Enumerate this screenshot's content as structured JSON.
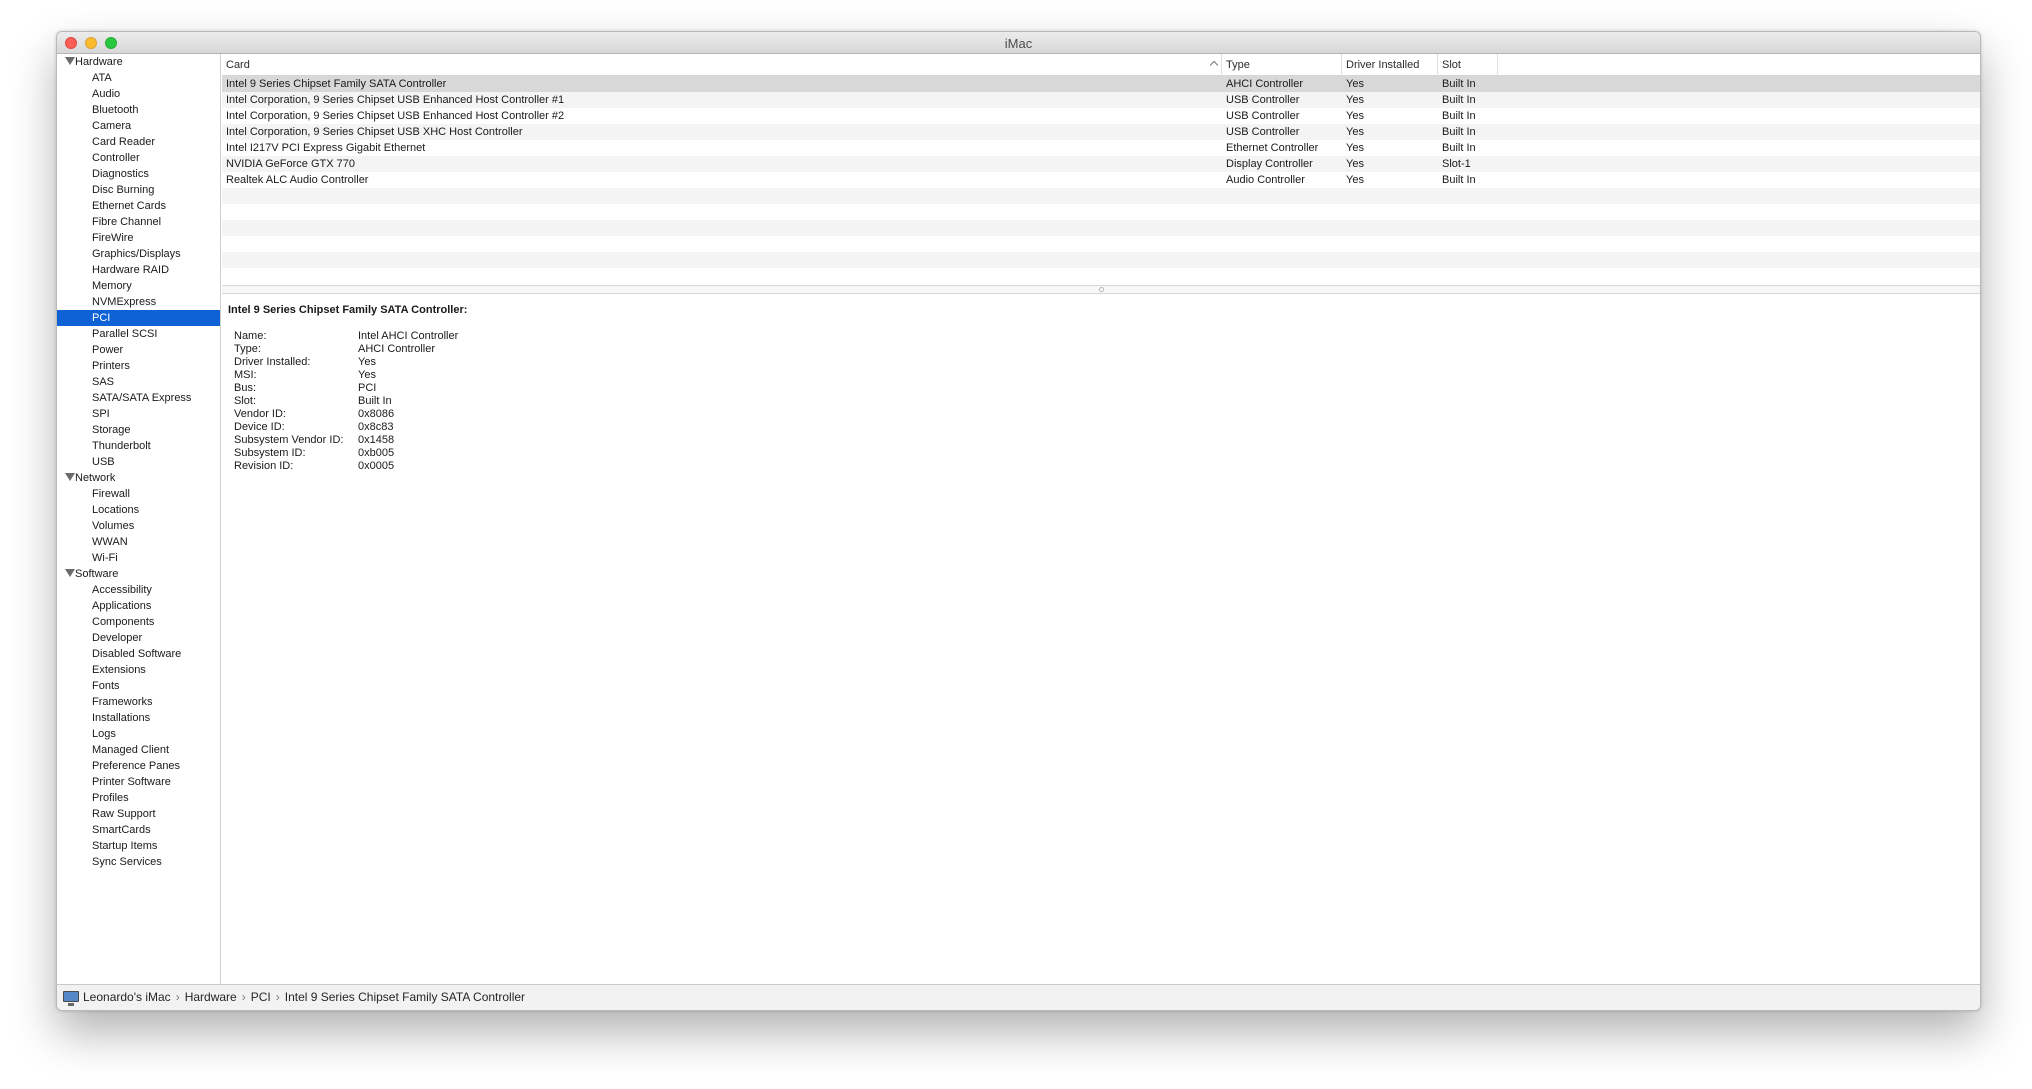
{
  "window": {
    "title": "iMac"
  },
  "sidebar": {
    "groups": [
      {
        "label": "Hardware",
        "items": [
          "ATA",
          "Audio",
          "Bluetooth",
          "Camera",
          "Card Reader",
          "Controller",
          "Diagnostics",
          "Disc Burning",
          "Ethernet Cards",
          "Fibre Channel",
          "FireWire",
          "Graphics/Displays",
          "Hardware RAID",
          "Memory",
          "NVMExpress",
          "PCI",
          "Parallel SCSI",
          "Power",
          "Printers",
          "SAS",
          "SATA/SATA Express",
          "SPI",
          "Storage",
          "Thunderbolt",
          "USB"
        ]
      },
      {
        "label": "Network",
        "items": [
          "Firewall",
          "Locations",
          "Volumes",
          "WWAN",
          "Wi-Fi"
        ]
      },
      {
        "label": "Software",
        "items": [
          "Accessibility",
          "Applications",
          "Components",
          "Developer",
          "Disabled Software",
          "Extensions",
          "Fonts",
          "Frameworks",
          "Installations",
          "Logs",
          "Managed Client",
          "Preference Panes",
          "Printer Software",
          "Profiles",
          "Raw Support",
          "SmartCards",
          "Startup Items",
          "Sync Services"
        ]
      }
    ],
    "selected": "PCI"
  },
  "table": {
    "columns": {
      "card": "Card",
      "type": "Type",
      "driver": "Driver Installed",
      "slot": "Slot"
    },
    "rows": [
      {
        "card": "Intel 9 Series Chipset Family SATA Controller",
        "type": "AHCI Controller",
        "driver": "Yes",
        "slot": "Built In"
      },
      {
        "card": "Intel Corporation, 9 Series Chipset USB Enhanced Host Controller #1",
        "type": "USB Controller",
        "driver": "Yes",
        "slot": "Built In"
      },
      {
        "card": "Intel Corporation, 9 Series Chipset USB Enhanced Host Controller #2",
        "type": "USB Controller",
        "driver": "Yes",
        "slot": "Built In"
      },
      {
        "card": "Intel Corporation, 9 Series Chipset USB XHC Host Controller",
        "type": "USB Controller",
        "driver": "Yes",
        "slot": "Built In"
      },
      {
        "card": "Intel I217V PCI Express Gigabit Ethernet",
        "type": "Ethernet Controller",
        "driver": "Yes",
        "slot": "Built In"
      },
      {
        "card": "NVIDIA GeForce GTX 770",
        "type": "Display Controller",
        "driver": "Yes",
        "slot": "Slot-1"
      },
      {
        "card": "Realtek ALC Audio Controller",
        "type": "Audio Controller",
        "driver": "Yes",
        "slot": "Built In"
      }
    ],
    "selected_row": 0
  },
  "detail": {
    "title": "Intel 9 Series Chipset Family SATA Controller:",
    "properties": [
      {
        "key": "Name:",
        "value": "Intel AHCI Controller"
      },
      {
        "key": "Type:",
        "value": "AHCI Controller"
      },
      {
        "key": "Driver Installed:",
        "value": "Yes"
      },
      {
        "key": "MSI:",
        "value": "Yes"
      },
      {
        "key": "Bus:",
        "value": "PCI"
      },
      {
        "key": "Slot:",
        "value": "Built In"
      },
      {
        "key": "Vendor ID:",
        "value": "0x8086"
      },
      {
        "key": "Device ID:",
        "value": "0x8c83"
      },
      {
        "key": "Subsystem Vendor ID:",
        "value": "0x1458"
      },
      {
        "key": "Subsystem ID:",
        "value": "0xb005"
      },
      {
        "key": "Revision ID:",
        "value": "0x0005"
      }
    ]
  },
  "statusbar": {
    "breadcrumbs": [
      "Leonardo's iMac",
      "Hardware",
      "PCI",
      "Intel 9 Series Chipset Family SATA Controller"
    ],
    "separator": "›"
  },
  "colors": {
    "selection": "#0f62d5",
    "row_selected": "#d8d8d8",
    "row_alt": "#f4f4f4"
  },
  "icons": {
    "computer": "imac-icon",
    "disclosure": "disclosure-triangle-icon",
    "sort": "sort-ascending-icon"
  }
}
